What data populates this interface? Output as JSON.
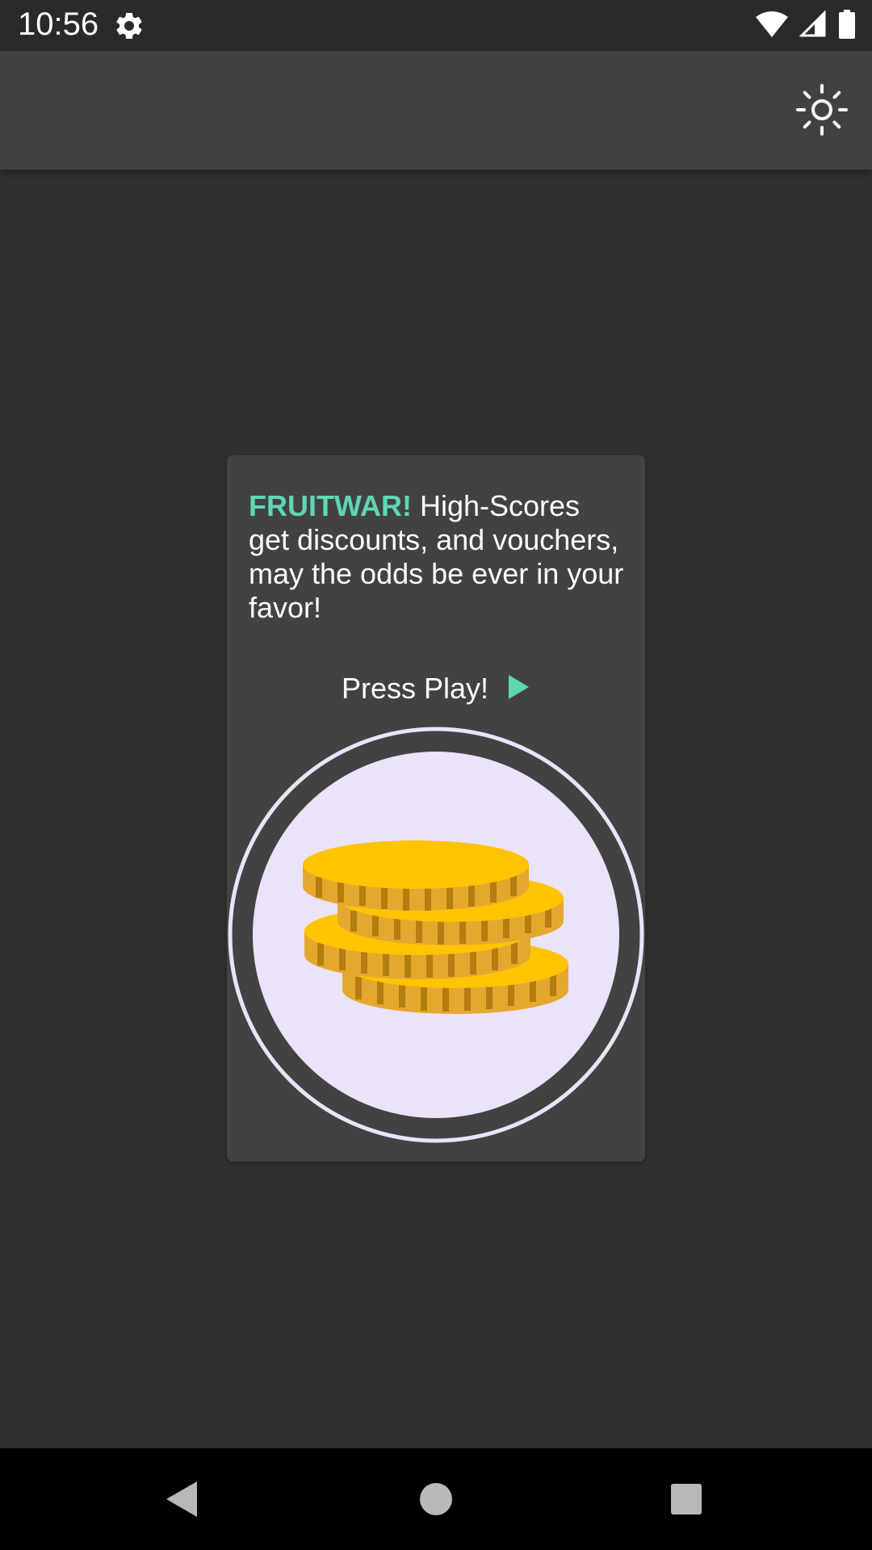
{
  "status_bar": {
    "time": "10:56",
    "icons": [
      "settings-icon",
      "wifi-icon",
      "cellular-signal-icon",
      "battery-icon"
    ]
  },
  "app_bar": {
    "action_icon": "brightness-icon"
  },
  "card": {
    "brand": "FRUITWAR!",
    "message": " High-Scores get discounts, and vouchers, may the odds be ever in your favor!",
    "press_play_label": "Press Play!",
    "play_icon": "play-arrow-icon",
    "coin_icon": "coin-stack-icon"
  },
  "nav_bar": {
    "icons": [
      "back-icon",
      "home-icon",
      "recents-icon"
    ]
  },
  "colors": {
    "accent": "#5fd6b4",
    "background": "#303030",
    "app_bar": "#424242",
    "card": "#424242",
    "coin_circle": "#ebe3fa",
    "coin_gold": "#ffc400"
  }
}
